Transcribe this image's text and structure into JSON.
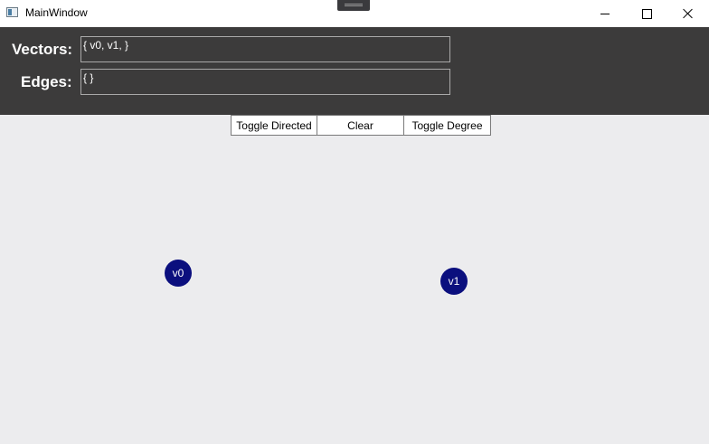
{
  "window": {
    "title": "MainWindow",
    "controls": {
      "minimize": "minimize-icon",
      "maximize": "maximize-icon",
      "close": "close-icon"
    }
  },
  "header": {
    "vectors_label": "Vectors:",
    "vectors_value": "{ v0, v1, }",
    "edges_label": "Edges:",
    "edges_value": "{ }"
  },
  "toolbar": {
    "toggle_directed": "Toggle Directed",
    "clear": "Clear",
    "toggle_degree": "Toggle Degree"
  },
  "graph": {
    "nodes": [
      {
        "label": "v0"
      },
      {
        "label": "v1"
      }
    ]
  },
  "colors": {
    "header_bg": "#3c3b3b",
    "canvas_bg": "#ececee",
    "node_fill": "#0b0f7e"
  }
}
